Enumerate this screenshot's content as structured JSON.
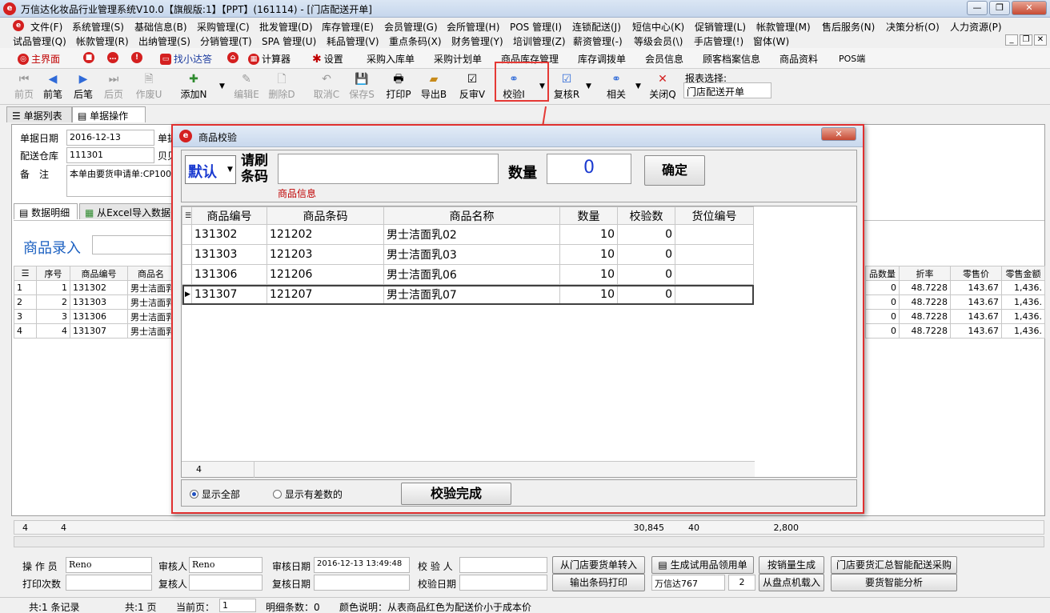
{
  "window": {
    "title": "万信达化妆品行业管理系统V10.0【旗舰版:1】【PPT】(161114) - [门店配送开单]",
    "min": "—",
    "max": "❐",
    "close": "✕"
  },
  "menu_row1": [
    "文件(F)",
    "系统管理(S)",
    "基础信息(B)",
    "采购管理(C)",
    "批发管理(D)",
    "库存管理(E)",
    "会员管理(G)",
    "会所管理(H)",
    "POS 管理(I)",
    "连锁配送(J)",
    "短信中心(K)",
    "促销管理(L)",
    "帐款管理(M)",
    "售后服务(N)",
    "决策分析(O)",
    "人力资源(P)"
  ],
  "menu_row2": [
    "试品管理(Q)",
    "帐款管理(R)",
    "出纳管理(S)",
    "分销管理(T)",
    "SPA 管理(U)",
    "耗品管理(V)",
    "重点条码(X)",
    "财务管理(Y)",
    "培训管理(Z)",
    "薪资管理(-)",
    "等级会员(\\)",
    "手店管理(!)",
    "窗体(W)"
  ],
  "nav": {
    "home": "主界面",
    "find": "找小达答",
    "calc": "计算器",
    "settings": "设置",
    "links": [
      "采购入库单",
      "采购计划单",
      "商品库存管理",
      "库存调拨单",
      "会员信息",
      "顾客档案信息",
      "商品资料",
      "POS端"
    ]
  },
  "toolbar": {
    "first": "前页",
    "prev": "前笔",
    "next": "后笔",
    "last": "后页",
    "void": "作废U",
    "add": "添加N",
    "edit": "编辑E",
    "delete": "删除D",
    "cancel": "取消C",
    "save": "保存S",
    "print": "打印P",
    "export": "导出B",
    "unaudit": "反审V",
    "verify": "校验I",
    "reaudit": "复核R",
    "related": "相关",
    "close": "关闭Q",
    "report_label": "报表选择:",
    "report_value": "门店配送开单"
  },
  "tabs": {
    "list": "单据列表",
    "operate": "单据操作"
  },
  "form": {
    "date_label": "单据日期",
    "date_value": "2016-12-13",
    "type_label": "单据",
    "warehouse_label": "配送仓库",
    "warehouse_value": "111301",
    "warehouse_extra": "贝贝",
    "note_label": "备　注",
    "note_value": "本单由要货申请单:CP100"
  },
  "subtabs": {
    "detail": "数据明细",
    "excel": "从Excel导入数据"
  },
  "entry_label": "商品录入",
  "main_grid": {
    "headers": [
      "序号",
      "商品编号",
      "商品名",
      "品数量",
      "折率",
      "零售价",
      "零售金额"
    ],
    "rows": [
      {
        "n": "1",
        "seq": "1",
        "code": "131302",
        "name": "男士洁面乳",
        "qty": "0",
        "rate": "48.7228",
        "price": "143.67",
        "amt": "1,436."
      },
      {
        "n": "2",
        "seq": "2",
        "code": "131303",
        "name": "男士洁面乳",
        "qty": "0",
        "rate": "48.7228",
        "price": "143.67",
        "amt": "1,436."
      },
      {
        "n": "3",
        "seq": "3",
        "code": "131306",
        "name": "男士洁面乳",
        "qty": "0",
        "rate": "48.7228",
        "price": "143.67",
        "amt": "1,436."
      },
      {
        "n": "4",
        "seq": "4",
        "code": "131307",
        "name": "男士洁面乳",
        "qty": "0",
        "rate": "48.7228",
        "price": "143.67",
        "amt": "1,436."
      }
    ],
    "footer": {
      "count": "4",
      "count2": "4",
      "total1": "30,845",
      "total2": "40",
      "total3": "2,800"
    }
  },
  "dialog": {
    "title": "商品校验",
    "mode": "默认",
    "scan_label": "请刷条码",
    "info": "商品信息",
    "qty_label": "数量",
    "qty_value": "0",
    "ok": "确定",
    "headers": [
      "商品编号",
      "商品条码",
      "商品名称",
      "数量",
      "校验数",
      "货位编号"
    ],
    "rows": [
      {
        "code": "131302",
        "barcode": "121202",
        "name": "男士洁面乳02",
        "qty": "10",
        "checked": "0",
        "loc": ""
      },
      {
        "code": "131303",
        "barcode": "121203",
        "name": "男士洁面乳03",
        "qty": "10",
        "checked": "0",
        "loc": ""
      },
      {
        "code": "131306",
        "barcode": "121206",
        "name": "男士洁面乳06",
        "qty": "10",
        "checked": "0",
        "loc": ""
      },
      {
        "code": "131307",
        "barcode": "121207",
        "name": "男士洁面乳07",
        "qty": "10",
        "checked": "0",
        "loc": ""
      }
    ],
    "footer_count": "4",
    "show_all": "显示全部",
    "show_diff": "显示有差数的",
    "finish": "校验完成"
  },
  "bottom": {
    "operator_label": "操 作 员",
    "operator": "Reno",
    "auditor_label": "审核人",
    "auditor": "Reno",
    "audit_date_label": "审核日期",
    "audit_date": "2016-12-13 13:49:48",
    "verifier_label": "校 验 人",
    "print_count_label": "打印次数",
    "reviewer_label": "复核人",
    "review_date_label": "复核日期",
    "verify_date_label": "校验日期",
    "btn_import": "从门店要货单转入",
    "btn_trial": "生成试用品领用单",
    "btn_sales": "按销量生成",
    "btn_smart": "门店要货汇总智能配送采购",
    "btn_barcode": "输出条码打印",
    "vendor": "万信达767",
    "spin": "2",
    "btn_scanner": "从盘点机载入",
    "btn_analysis": "要货智能分析"
  },
  "status": {
    "records": "共:1 条记录",
    "pages": "共:1 页",
    "current_label": "当前页：",
    "current": "1",
    "detail": "明细条数：0",
    "color_note": "颜色说明：从表商品红色为配送价小于成本价"
  }
}
